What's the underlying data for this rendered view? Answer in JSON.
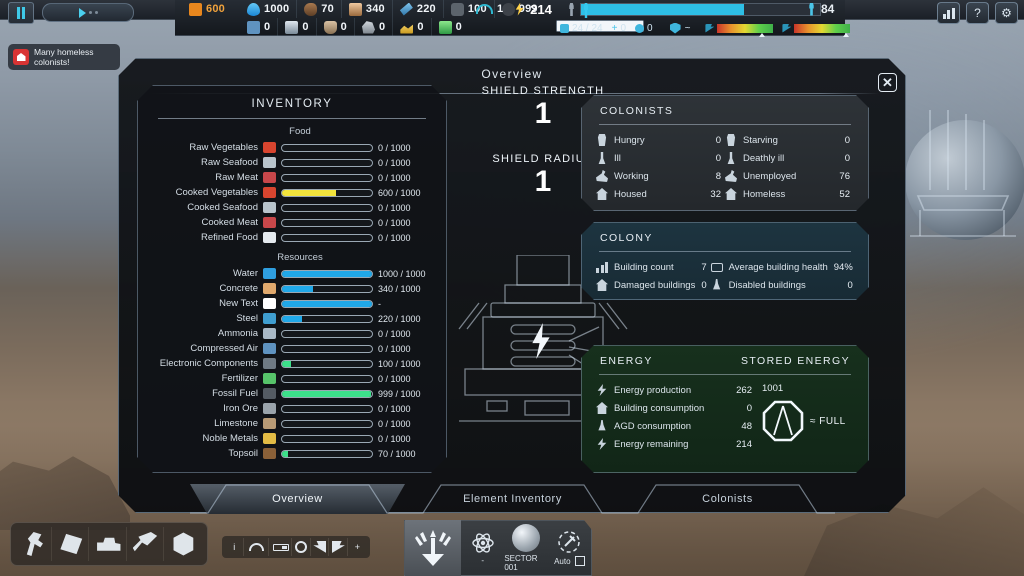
{
  "hud": {
    "pause_icon": "pause-icon",
    "speed_icon": "play-speed-icon",
    "food": {
      "icon": "food-icon",
      "value": "600"
    },
    "resources_row1": [
      {
        "icon": "water-icon",
        "value": "1000"
      },
      {
        "icon": "topsoil-icon",
        "value": "70"
      },
      {
        "icon": "concrete-icon",
        "value": "340"
      },
      {
        "icon": "steel-icon",
        "value": "220"
      },
      {
        "icon": "electronic-components-icon",
        "value": "100"
      },
      {
        "icon": "fossil-fuel-icon",
        "value": "999"
      }
    ],
    "resources_row2": [
      {
        "icon": "compressed-air-icon",
        "value": "0"
      },
      {
        "icon": "ammonia-icon",
        "value": "0"
      },
      {
        "icon": "limestone-icon",
        "value": "0"
      },
      {
        "icon": "iron-ore-icon",
        "value": "0"
      },
      {
        "icon": "noble-metals-icon",
        "value": "0"
      },
      {
        "icon": "fertilizer-icon",
        "value": "0"
      }
    ],
    "shield_arc": {
      "icon": "shield-arc-icon",
      "value": "1"
    },
    "power": {
      "icon": "power-icon",
      "value": "214"
    },
    "storage_fill_pct": 100,
    "population_fill_pct": 68,
    "stats": [
      {
        "icon": "bed-icon",
        "value": "24 / 24"
      },
      {
        "icon": "plus-icon",
        "value": "0"
      },
      {
        "icon": "skull-icon",
        "value": "0"
      }
    ],
    "defense_icon": "shield-badge-icon",
    "defense_value": "~",
    "morale_bars": [
      {
        "icon": "flag-left-icon",
        "marker_pct": 74
      },
      {
        "icon": "flag-right-icon",
        "marker_pct": 86
      }
    ],
    "colonist_count": {
      "icon": "colonist-icon",
      "value": "84"
    },
    "buttons": [
      {
        "icon": "statistics-icon",
        "label": ""
      },
      {
        "icon": "help-icon",
        "label": "?"
      },
      {
        "icon": "settings-gear-icon",
        "label": "⚙"
      }
    ]
  },
  "alert": {
    "icon": "homeless-alert-icon",
    "text": "Many homeless colonists!"
  },
  "panel": {
    "title": "Overview",
    "close_label": "✕"
  },
  "inventory": {
    "title": "INVENTORY",
    "groups": [
      {
        "name": "Food",
        "items": [
          {
            "label": "Raw Vegetables",
            "icon": "raw-vegetables-icon",
            "value": "0 / 1000",
            "fill_pct": 0,
            "color": "#f2e43c",
            "icon_color": "#d8452f"
          },
          {
            "label": "Raw Seafood",
            "icon": "raw-seafood-icon",
            "value": "0 / 1000",
            "fill_pct": 0,
            "color": "#f2e43c",
            "icon_color": "#b9c4cc"
          },
          {
            "label": "Raw Meat",
            "icon": "raw-meat-icon",
            "value": "0 / 1000",
            "fill_pct": 0,
            "color": "#f2e43c",
            "icon_color": "#c8474a"
          },
          {
            "label": "Cooked Vegetables",
            "icon": "cooked-vegetables-icon",
            "value": "600 / 1000",
            "fill_pct": 60,
            "color": "#f2e43c",
            "icon_color": "#d8452f"
          },
          {
            "label": "Cooked Seafood",
            "icon": "cooked-seafood-icon",
            "value": "0 / 1000",
            "fill_pct": 0,
            "color": "#f2e43c",
            "icon_color": "#b9c4cc"
          },
          {
            "label": "Cooked Meat",
            "icon": "cooked-meat-icon",
            "value": "0 / 1000",
            "fill_pct": 0,
            "color": "#f2e43c",
            "icon_color": "#c8474a"
          },
          {
            "label": "Refined Food",
            "icon": "refined-food-icon",
            "value": "0 / 1000",
            "fill_pct": 0,
            "color": "#f2e43c",
            "icon_color": "#e4e9ee"
          }
        ]
      },
      {
        "name": "Resources",
        "items": [
          {
            "label": "Water",
            "icon": "water-icon",
            "value": "1000 / 1000",
            "fill_pct": 100,
            "color": "#20a8e8",
            "icon_color": "#2f9fe0"
          },
          {
            "label": "Concrete",
            "icon": "concrete-icon",
            "value": "340 / 1000",
            "fill_pct": 34,
            "color": "#20a8e8",
            "icon_color": "#e0a96d"
          },
          {
            "label": "New Text",
            "icon": "new-text-icon",
            "value": "-",
            "fill_pct": 100,
            "color": "#20a8e8",
            "icon_color": "#ffffff"
          },
          {
            "label": "Steel",
            "icon": "steel-icon",
            "value": "220 / 1000",
            "fill_pct": 22,
            "color": "#20a8e8",
            "icon_color": "#3f9ed0"
          },
          {
            "label": "Ammonia",
            "icon": "ammonia-icon",
            "value": "0 / 1000",
            "fill_pct": 0,
            "color": "#20a8e8",
            "icon_color": "#a9b9c6"
          },
          {
            "label": "Compressed Air",
            "icon": "compressed-air-icon",
            "value": "0 / 1000",
            "fill_pct": 0,
            "color": "#20a8e8",
            "icon_color": "#5f93c0"
          },
          {
            "label": "Electronic Components",
            "icon": "electronic-components-icon",
            "value": "100 / 1000",
            "fill_pct": 10,
            "color": "#3ce08a",
            "icon_color": "#6f7a84"
          },
          {
            "label": "Fertilizer",
            "icon": "fertilizer-icon",
            "value": "0 / 1000",
            "fill_pct": 0,
            "color": "#3ce08a",
            "icon_color": "#57c46a"
          },
          {
            "label": "Fossil Fuel",
            "icon": "fossil-fuel-icon",
            "value": "999 / 1000",
            "fill_pct": 99,
            "color": "#3ce08a",
            "icon_color": "#545b63"
          },
          {
            "label": "Iron Ore",
            "icon": "iron-ore-icon",
            "value": "0 / 1000",
            "fill_pct": 0,
            "color": "#3ce08a",
            "icon_color": "#9aa3ab"
          },
          {
            "label": "Limestone",
            "icon": "limestone-icon",
            "value": "0 / 1000",
            "fill_pct": 0,
            "color": "#3ce08a",
            "icon_color": "#b89a76"
          },
          {
            "label": "Noble Metals",
            "icon": "noble-metals-icon",
            "value": "0 / 1000",
            "fill_pct": 0,
            "color": "#3ce08a",
            "icon_color": "#e3bb45"
          },
          {
            "label": "Topsoil",
            "icon": "topsoil-icon",
            "value": "70 / 1000",
            "fill_pct": 7,
            "color": "#3ce08a",
            "icon_color": "#8a6038"
          }
        ]
      }
    ]
  },
  "shield": {
    "strength_label": "SHIELD STRENGTH",
    "strength_value": "1",
    "radius_label": "SHIELD RADIUS",
    "radius_value": "1",
    "tower_icon": "shield-generator-tower"
  },
  "colonists_panel": {
    "title": "COLONISTS",
    "items": [
      {
        "label": "Hungry",
        "icon": "hungry-icon",
        "value": "0"
      },
      {
        "label": "Starving",
        "icon": "starving-icon",
        "value": "0"
      },
      {
        "label": "Ill",
        "icon": "ill-icon",
        "value": "0"
      },
      {
        "label": "Deathly ill",
        "icon": "deathly-ill-icon",
        "value": "0"
      },
      {
        "label": "Working",
        "icon": "working-icon",
        "value": "8"
      },
      {
        "label": "Unemployed",
        "icon": "unemployed-icon",
        "value": "76"
      },
      {
        "label": "Housed",
        "icon": "housed-icon",
        "value": "32"
      },
      {
        "label": "Homeless",
        "icon": "homeless-icon",
        "value": "52"
      }
    ]
  },
  "colony_panel": {
    "title": "COLONY",
    "items": [
      {
        "label": "Building count",
        "icon": "building-count-icon",
        "value": "7"
      },
      {
        "label": "Average building health",
        "icon": "health-bar-icon",
        "value": "94%"
      },
      {
        "label": "Damaged buildings",
        "icon": "damaged-building-icon",
        "value": "0"
      },
      {
        "label": "Disabled buildings",
        "icon": "disabled-building-icon",
        "value": "0"
      }
    ]
  },
  "energy_panel": {
    "title": "ENERGY",
    "stored_title": "STORED ENERGY",
    "stored_value": "1001",
    "stored_status": "≈ FULL",
    "battery_icon": "battery-octagon-icon",
    "items": [
      {
        "label": "Energy production",
        "icon": "energy-production-icon",
        "value": "262"
      },
      {
        "label": "Building consumption",
        "icon": "building-consumption-icon",
        "value": "0"
      },
      {
        "label": "AGD consumption",
        "icon": "agd-consumption-icon",
        "value": "48"
      },
      {
        "label": "Energy remaining",
        "icon": "energy-remaining-icon",
        "value": "214"
      }
    ]
  },
  "tabs": [
    {
      "label": "Overview",
      "active": true
    },
    {
      "label": "Element Inventory",
      "active": false
    },
    {
      "label": "Colonists",
      "active": false
    }
  ],
  "build_toolbar": [
    {
      "icon": "hammer-icon"
    },
    {
      "icon": "plate-icon"
    },
    {
      "icon": "bulldozer-icon"
    },
    {
      "icon": "drill-icon"
    },
    {
      "icon": "nut-icon"
    }
  ],
  "mini_toolbar": [
    {
      "icon": "info-icon",
      "label": "i"
    },
    {
      "icon": "arc-icon",
      "label": ""
    },
    {
      "icon": "ruler-icon",
      "label": ""
    },
    {
      "icon": "gear-tool-icon",
      "label": ""
    },
    {
      "icon": "flag-left-icon",
      "label": ""
    },
    {
      "icon": "flag-right-icon",
      "label": ""
    },
    {
      "icon": "plus-icon",
      "label": "+"
    }
  ],
  "sector_bar": {
    "main_icon": "shield-generator-button",
    "cells": [
      {
        "icon": "atom-icon",
        "label": "-"
      },
      {
        "icon": "sector-globe-icon",
        "label": "SECTOR 001"
      },
      {
        "icon": "auto-mine-icon",
        "label": "Auto"
      }
    ]
  }
}
